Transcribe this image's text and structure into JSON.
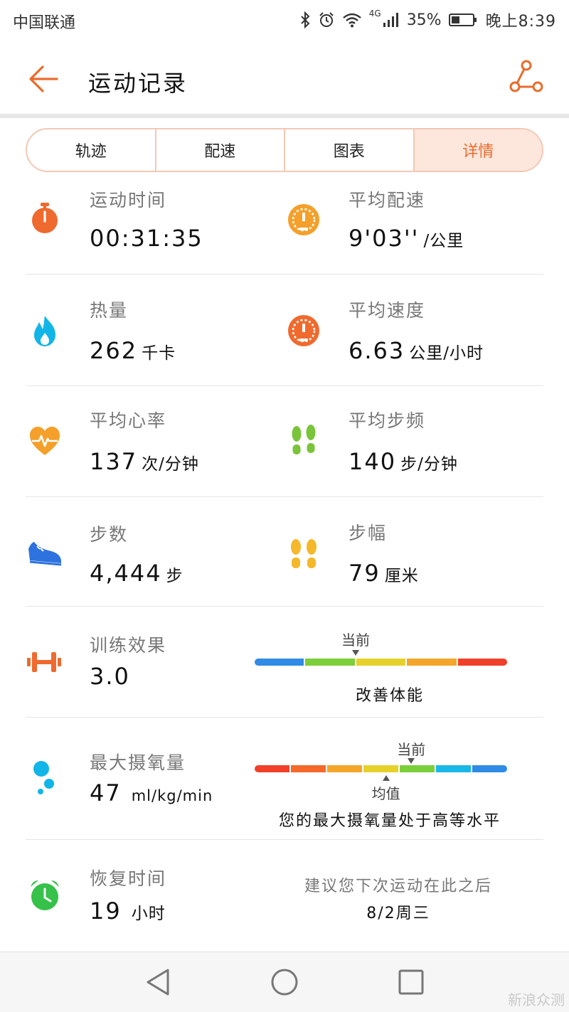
{
  "status_bar": {
    "carrier": "中国联通",
    "network": "4G",
    "battery": "35%",
    "time": "晚上8:39"
  },
  "header": {
    "title": "运动记录"
  },
  "tabs": [
    {
      "label": "轨迹",
      "active": false
    },
    {
      "label": "配速",
      "active": false
    },
    {
      "label": "图表",
      "active": false
    },
    {
      "label": "详情",
      "active": true
    }
  ],
  "metrics": {
    "duration": {
      "label": "运动时间",
      "value": "00:31:35",
      "unit": ""
    },
    "avg_pace": {
      "label": "平均配速",
      "value": "9'03''",
      "unit": "/公里"
    },
    "calories": {
      "label": "热量",
      "value": "262",
      "unit": "千卡"
    },
    "avg_speed": {
      "label": "平均速度",
      "value": "6.63",
      "unit": "公里/小时"
    },
    "avg_heart_rate": {
      "label": "平均心率",
      "value": "137",
      "unit": "次/分钟"
    },
    "avg_cadence": {
      "label": "平均步频",
      "value": "140",
      "unit": "步/分钟"
    },
    "steps": {
      "label": "步数",
      "value": "4,444",
      "unit": "步"
    },
    "stride": {
      "label": "步幅",
      "value": "79",
      "unit": "厘米"
    }
  },
  "training_effect": {
    "label": "训练效果",
    "value": "3.0",
    "current_label": "当前",
    "description": "改善体能",
    "current_position": 0.4,
    "scale_colors": [
      "#2f8be6",
      "#7bcf3a",
      "#e6d12a",
      "#f4a62a",
      "#f0402a"
    ]
  },
  "vo2max": {
    "label": "最大摄氧量",
    "value": "47",
    "unit": "ml/kg/min",
    "current_label": "当前",
    "average_label": "均值",
    "description": "您的最大摄氧量处于高等水平",
    "current_position": 0.62,
    "average_position": 0.52,
    "scale_colors": [
      "#f0402a",
      "#f4682a",
      "#f4a62a",
      "#e6d12a",
      "#7bcf3a",
      "#1ab8e6",
      "#2f8be6"
    ]
  },
  "recovery": {
    "label": "恢复时间",
    "value": "19",
    "unit": "小时",
    "advice": "建议您下次运动在此之后",
    "date": "8/2周三"
  },
  "watermark": "新浪众测",
  "colors": {
    "accent": "#e96c2c",
    "tab_border": "#f3c8b5",
    "tab_active_bg": "#fde6dc"
  }
}
